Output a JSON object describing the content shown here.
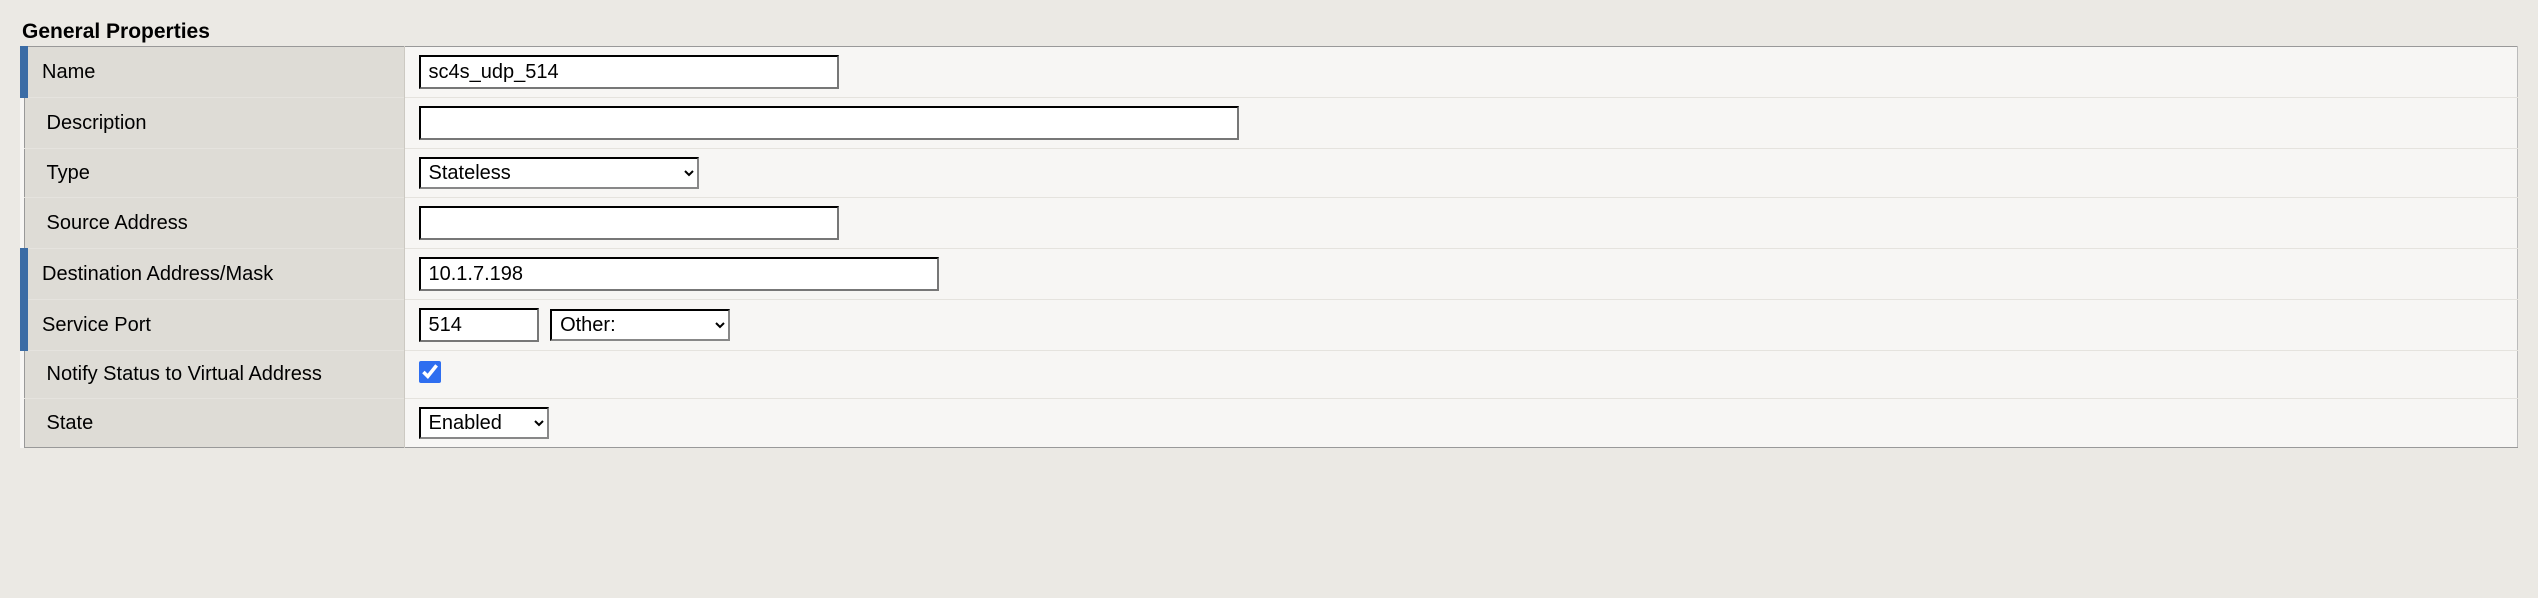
{
  "section_title": "General Properties",
  "fields": {
    "name": {
      "label": "Name",
      "value": "sc4s_udp_514"
    },
    "desc": {
      "label": "Description",
      "value": ""
    },
    "type": {
      "label": "Type",
      "selected": "Stateless"
    },
    "src": {
      "label": "Source Address",
      "value": ""
    },
    "dest": {
      "label": "Destination Address/Mask",
      "value": "10.1.7.198"
    },
    "port": {
      "label": "Service Port",
      "value": "514",
      "selected": "Other:"
    },
    "notify": {
      "label": "Notify Status to Virtual Address",
      "checked": true
    },
    "state": {
      "label": "State",
      "selected": "Enabled"
    }
  }
}
